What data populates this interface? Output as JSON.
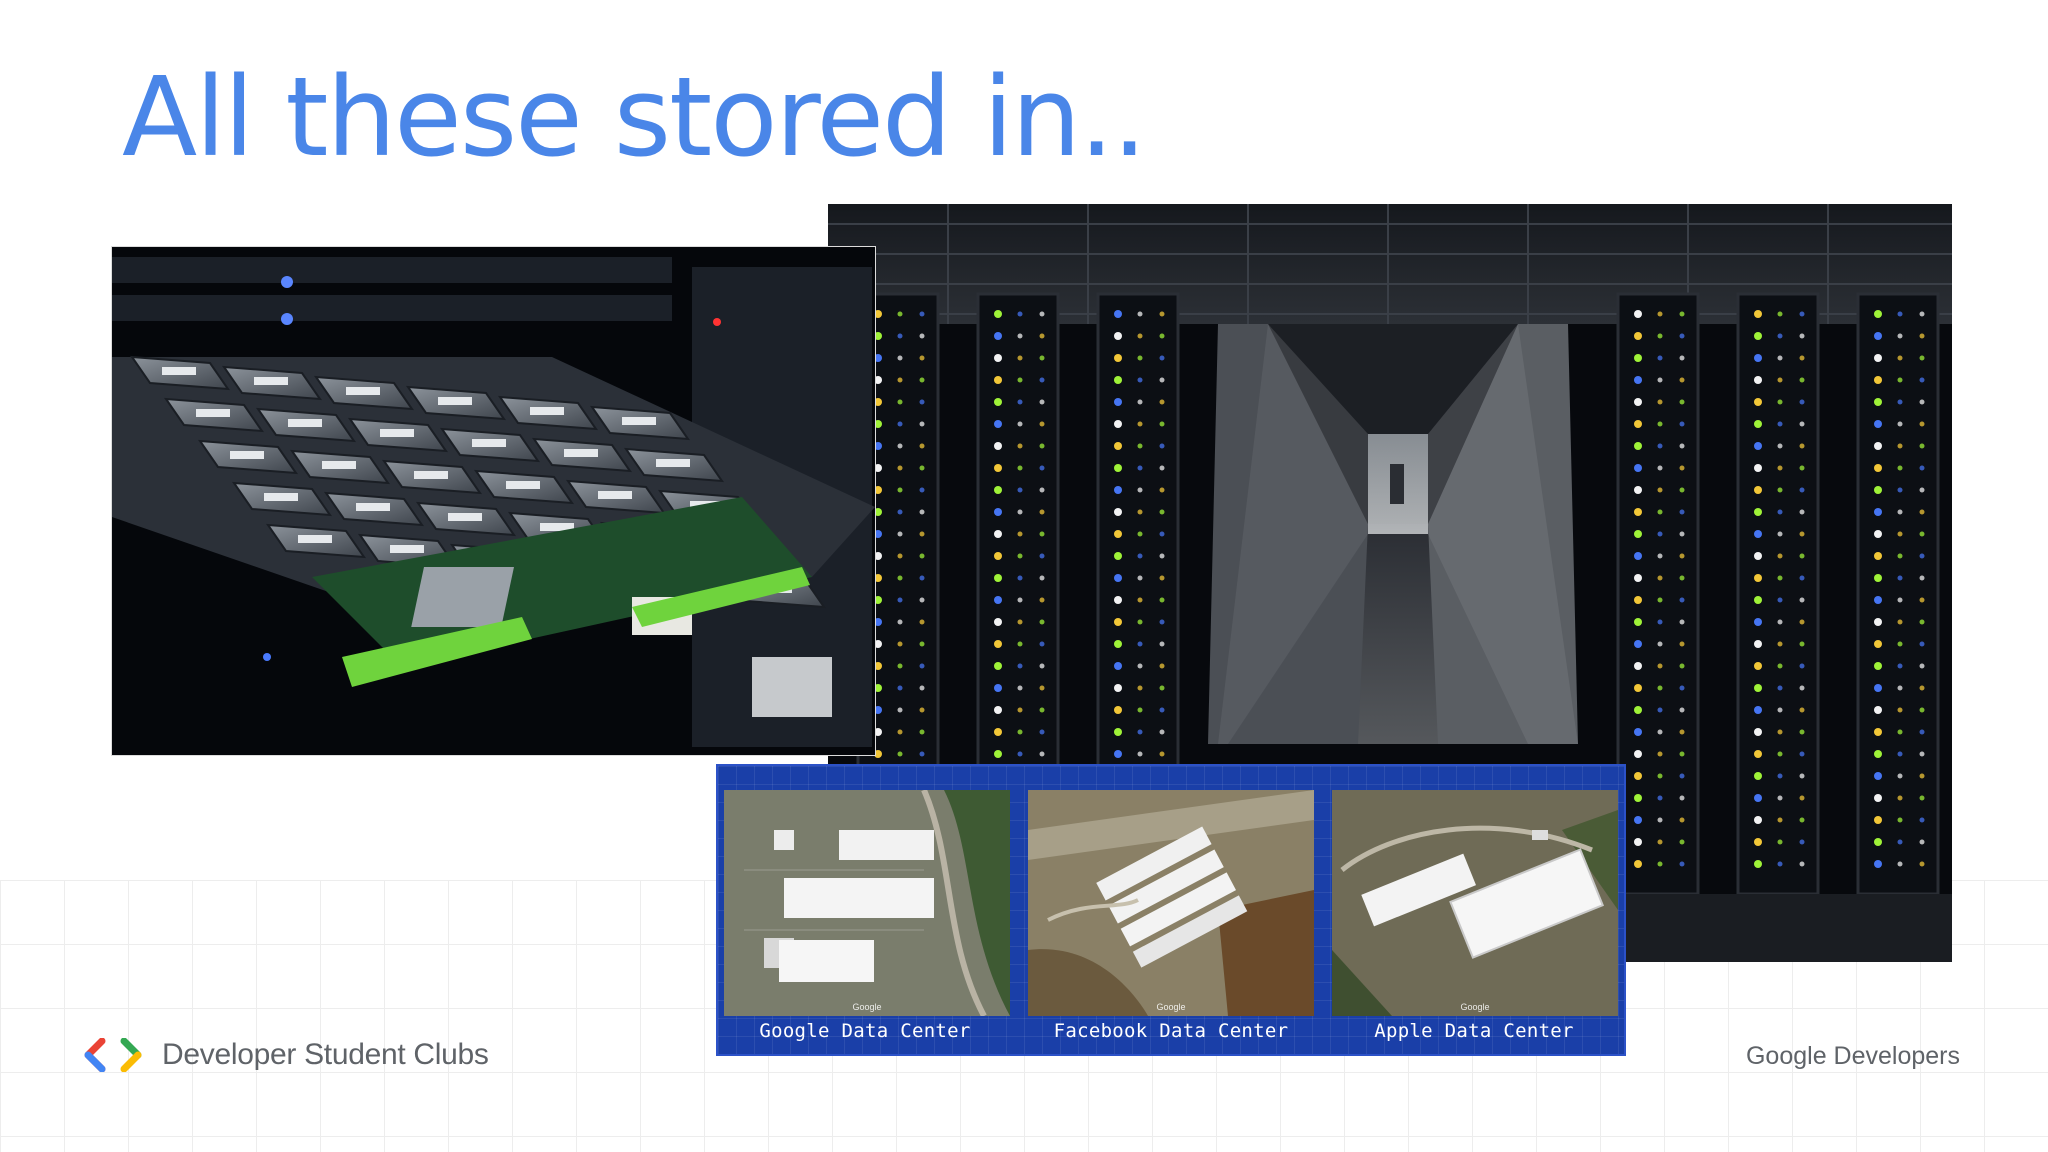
{
  "slide": {
    "title": "All these stored in.."
  },
  "images": {
    "server_photo": "server-drive-tray-photo",
    "hallway_photo": "data-center-hallway-photo"
  },
  "aerial": {
    "panels": [
      {
        "caption": "Google Data Center",
        "watermark": "Google"
      },
      {
        "caption": "Facebook Data Center",
        "watermark": "Google"
      },
      {
        "caption": "Apple Data Center",
        "watermark": "Google"
      }
    ]
  },
  "footer": {
    "left_brand": "Developer Student Clubs",
    "right_brand": "Google Developers"
  },
  "colors": {
    "title": "#4a86e8",
    "panel_blue": "#1a3fa8",
    "footer_text": "#5f6368",
    "logo_red": "#ea4335",
    "logo_blue": "#4285f4",
    "logo_green": "#34a853",
    "logo_yellow": "#fbbc04"
  }
}
